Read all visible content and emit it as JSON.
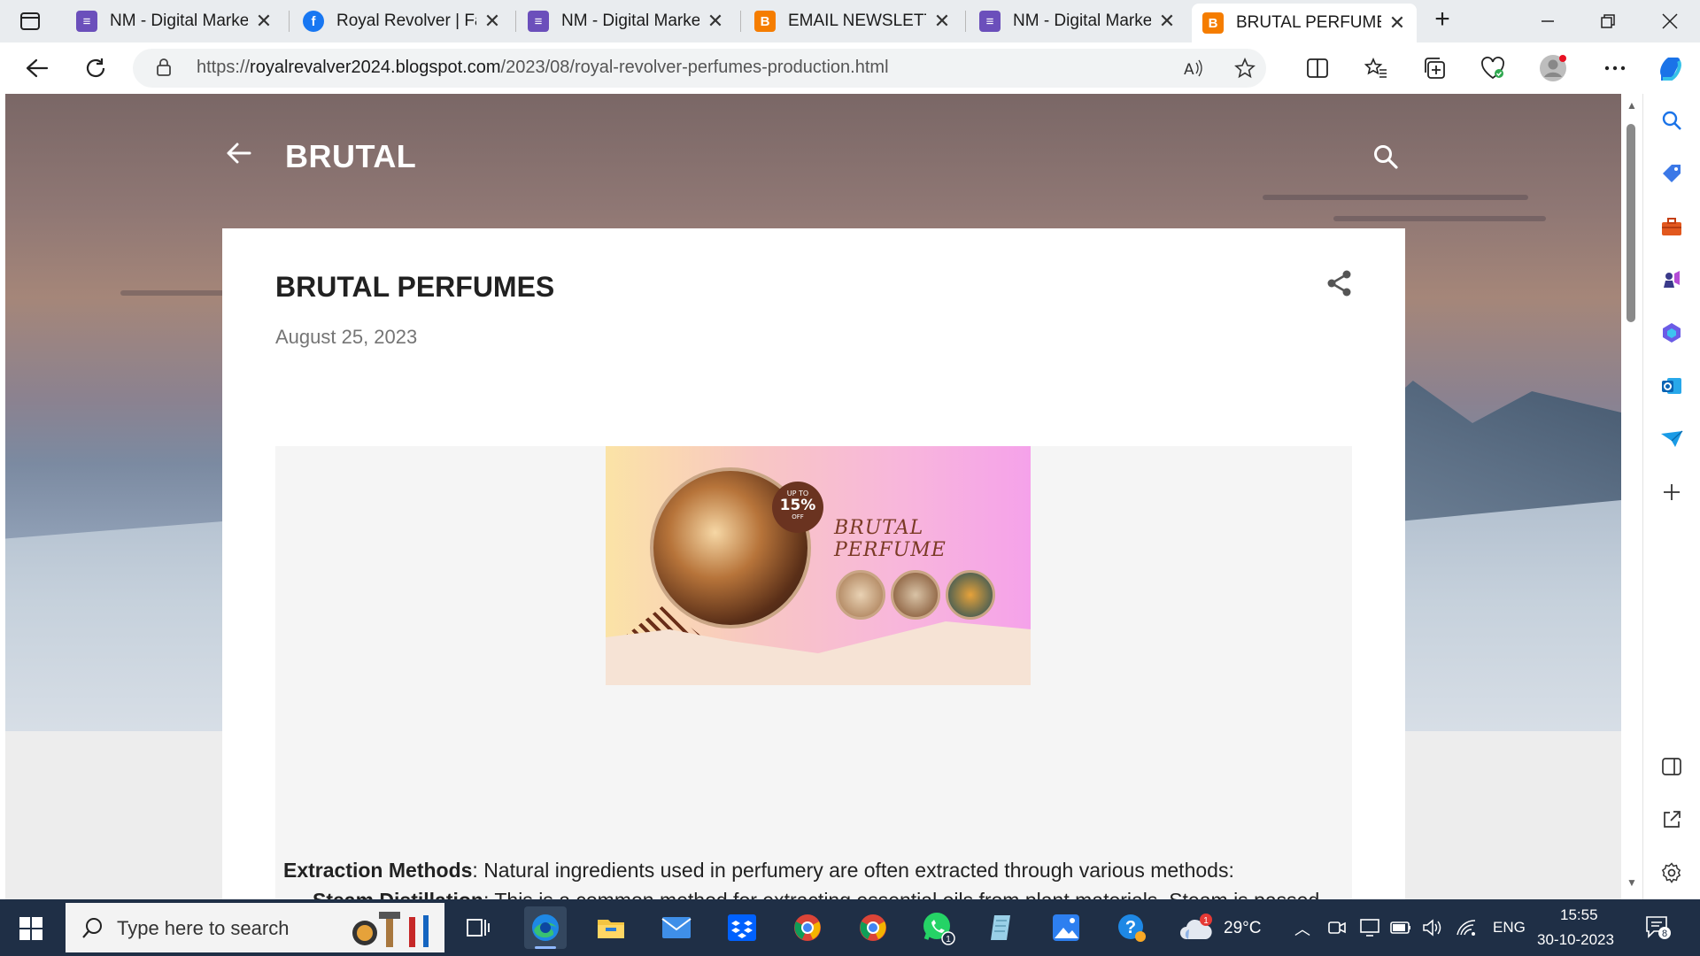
{
  "browser": {
    "tabs": [
      {
        "title": "NM - Digital Marketi",
        "favicon": "list-icon",
        "color": "#6b4fbb"
      },
      {
        "title": "Royal Revolver | Fac",
        "favicon": "facebook-icon",
        "color": "#1877f2"
      },
      {
        "title": "NM - Digital Marketi",
        "favicon": "list-icon",
        "color": "#6b4fbb"
      },
      {
        "title": "EMAIL NEWSLETTER",
        "favicon": "blogger-icon",
        "color": "#f57d00"
      },
      {
        "title": "NM - Digital Marketi",
        "favicon": "list-icon",
        "color": "#6b4fbb"
      },
      {
        "title": "BRUTAL PERFUMES",
        "favicon": "blogger-icon",
        "color": "#f57d00",
        "active": true
      }
    ],
    "url": {
      "scheme": "https://",
      "host": "royalrevalver2024.blogspot.com",
      "path": "/2023/08/royal-revolver-perfumes-production.html"
    }
  },
  "blog": {
    "header_title": "BRUTAL",
    "post": {
      "title": "BRUTAL PERFUMES",
      "date": "August 25, 2023",
      "banner": {
        "badge_top": "UP TO",
        "badge_value": "15%",
        "badge_bottom": "OFF",
        "title": "BRUTAL PERFUME"
      },
      "paragraphs": [
        {
          "term": "Extraction Methods",
          "text": ": Natural ingredients used in perfumery are often extracted through various methods:"
        },
        {
          "term": "Steam Distillation",
          "text": ": This is a common method for extracting essential oils from plant materials. Steam is passed"
        }
      ]
    }
  },
  "taskbar": {
    "search_placeholder": "Type here to search",
    "weather": "29°C",
    "weather_badge": "1",
    "whatsapp_badge": "1",
    "language": "ENG",
    "time": "15:55",
    "date": "30-10-2023",
    "notifications": "8"
  }
}
